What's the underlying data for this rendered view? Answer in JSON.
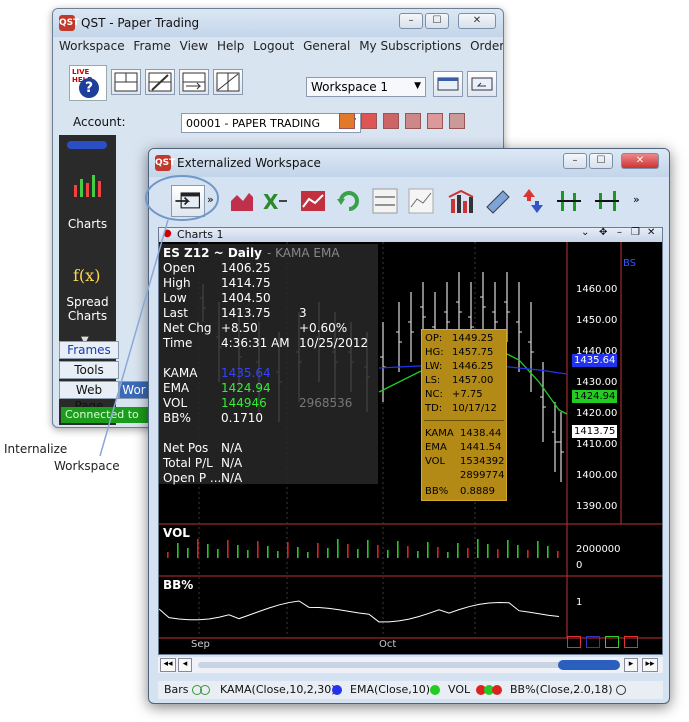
{
  "back_window": {
    "title": "QST - Paper Trading",
    "icon_text": "QST",
    "menu": [
      "Workspace",
      "Frame",
      "View",
      "Help",
      "Logout",
      "General",
      "My Subscriptions",
      "Order Entry"
    ],
    "live_help_label": "LIVE HELP",
    "workspace_select": "Workspace 1",
    "account_label": "Account:",
    "account_value": "00001 - PAPER TRADING",
    "side_items": [
      {
        "label": "Charts"
      },
      {
        "label": "Spread Charts"
      }
    ],
    "tabs": [
      "Frames",
      "Tools",
      "Web Page"
    ],
    "tab_cut": "Wor",
    "status": "Connected to"
  },
  "front_window": {
    "title": "Externalized Workspace",
    "chart_window_title": "Charts 1",
    "overlay_label": "BS"
  },
  "info_panel": {
    "symbol": "ES Z12 ~ Daily",
    "indicator_hint": "- KAMA EMA",
    "rows": [
      {
        "label": "Open",
        "value": "1406.25"
      },
      {
        "label": "High",
        "value": "1414.75"
      },
      {
        "label": "Low",
        "value": "1404.50"
      },
      {
        "label": "Last",
        "value": "1413.75",
        "extra": "3"
      },
      {
        "label": "Net Chg",
        "value": "+8.50",
        "extra": "+0.60%"
      },
      {
        "label": "Time",
        "value": "4:36:31 AM",
        "extra": "10/25/2012"
      }
    ],
    "indicators": [
      {
        "label": "KAMA",
        "value": "1435.64",
        "color": "#3333ff"
      },
      {
        "label": "EMA",
        "value": "1424.94",
        "color": "#33dd33"
      },
      {
        "label": "VOL",
        "value": "144946",
        "color": "#33dd33",
        "extra": "2968536"
      },
      {
        "label": "BB%",
        "value": "0.1710",
        "color": "#ffffff"
      }
    ],
    "positions": [
      {
        "label": "Net Pos",
        "value": "N/A"
      },
      {
        "label": "Total P/L",
        "value": "N/A"
      },
      {
        "label": "Open P ...",
        "value": "N/A"
      }
    ]
  },
  "popup": {
    "rows": [
      {
        "label": "OP:",
        "value": "1449.25"
      },
      {
        "label": "HG:",
        "value": "1457.75"
      },
      {
        "label": "LW:",
        "value": "1446.25"
      },
      {
        "label": "LS:",
        "value": "1457.00"
      },
      {
        "label": "NC:",
        "value": "+7.75"
      },
      {
        "label": "TD:",
        "value": "10/17/12"
      }
    ],
    "indicators": [
      {
        "label": "KAMA",
        "value": "1438.44"
      },
      {
        "label": "EMA",
        "value": "1441.54"
      },
      {
        "label": "VOL",
        "value": "1534392"
      },
      {
        "label": "",
        "value": "2899774"
      },
      {
        "label": "BB%",
        "value": "0.8889"
      }
    ]
  },
  "price_axis": {
    "ticks": [
      "1460.00",
      "1450.00",
      "1440.00",
      "1430.00",
      "1420.00",
      "1410.00",
      "1400.00",
      "1390.00"
    ],
    "kama_box": "1435.64",
    "ema_box": "1424.94",
    "last_box": "1413.75",
    "vol_ticks": [
      "2000000",
      "0"
    ],
    "bb_ticks": [
      "1"
    ]
  },
  "panes": {
    "volume": "VOL",
    "bb": "BB%"
  },
  "x_axis": {
    "labels": [
      "Sep",
      "Oct"
    ]
  },
  "legend": {
    "bars": "Bars",
    "kama": "KAMA(Close,10,2,30)",
    "ema": "EMA(Close,10)",
    "vol": "VOL",
    "bb": "BB%(Close,2.0,18)"
  },
  "callout": {
    "line1": "Internalize",
    "line2": "Workspace"
  },
  "colors": {
    "kama": "#2233ff",
    "ema": "#22cc22",
    "popup": "#b48a17",
    "volume_up": "#22cc22",
    "volume_down": "#dd2222"
  }
}
